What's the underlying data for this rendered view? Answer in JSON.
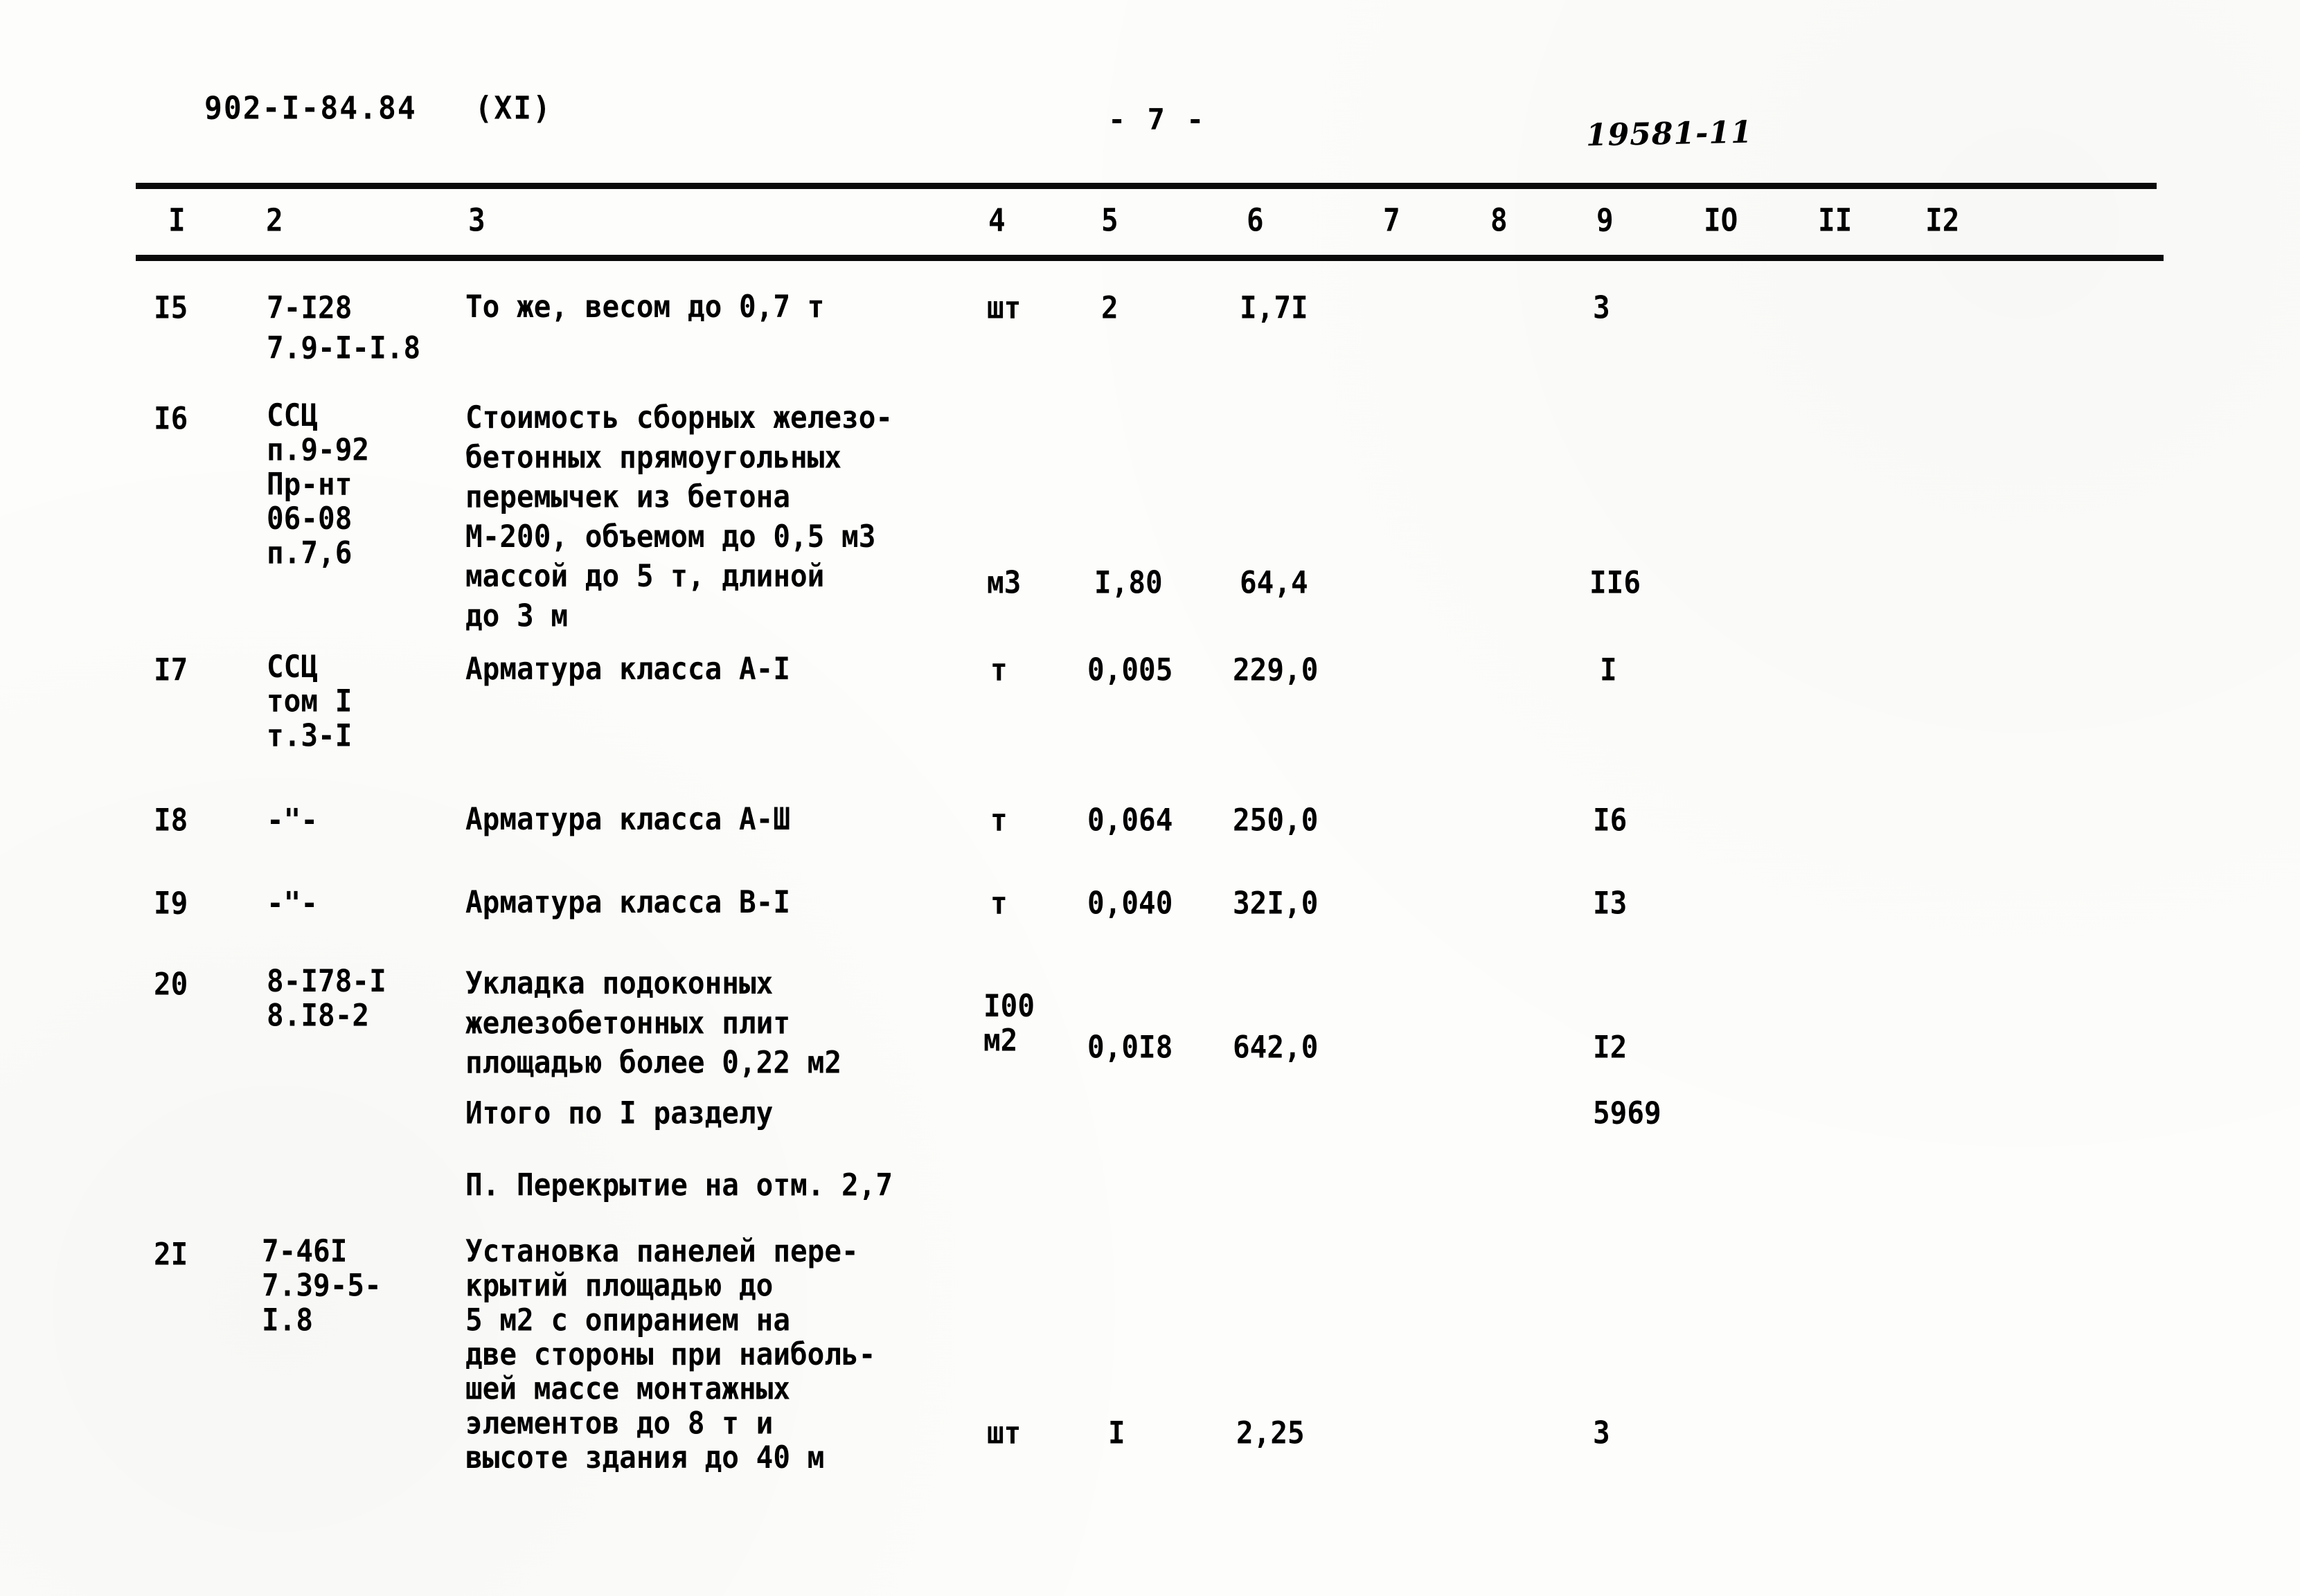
{
  "header": {
    "doc_code": "902-I-84.84   (XI)",
    "page_number": "- 7 -",
    "stamp_number": "19581-11"
  },
  "table": {
    "column_headers": [
      "I",
      "2",
      "3",
      "4",
      "5",
      "6",
      "7",
      "8",
      "9",
      "IO",
      "II",
      "I2"
    ],
    "rows": [
      {
        "num": "I5",
        "code": "7-I28\n7.9-I-I.8",
        "description": "То же, весом до 0,7 т",
        "unit": "шт",
        "qty": "2",
        "price": "I,7I",
        "col7": "",
        "col8": "",
        "total": "3"
      },
      {
        "num": "I6",
        "code": "ССЦ\nп.9-92\nПр-нт\n06-08\nп.7,6",
        "description": "Стоимость сборных железо-\nбетонных прямоугольных\nперемычек из бетона\nМ-200, объемом до 0,5 м3\nмассой до 5 т, длиной\nдо 3 м",
        "unit": "м3",
        "qty": "I,80",
        "price": "64,4",
        "col7": "",
        "col8": "",
        "total": "II6"
      },
      {
        "num": "I7",
        "code": "ССЦ\nтом I\nт.3-I",
        "description": "Арматура класса А-I",
        "unit": "т",
        "qty": "0,005",
        "price": "229,0",
        "col7": "",
        "col8": "",
        "total": "I"
      },
      {
        "num": "I8",
        "code": "-\"-",
        "description": "Арматура класса А-Ш",
        "unit": "т",
        "qty": "0,064",
        "price": "250,0",
        "col7": "",
        "col8": "",
        "total": "I6"
      },
      {
        "num": "I9",
        "code": "-\"-",
        "description": "Арматура класса В-I",
        "unit": "т",
        "qty": "0,040",
        "price": "32I,0",
        "col7": "",
        "col8": "",
        "total": "I3"
      },
      {
        "num": "20",
        "code": "8-I78-I\n8.I8-2",
        "description": "Укладка подоконных\nжелезобетонных плит\nплощадью более 0,22 м2",
        "unit": "I00\nм2",
        "qty": "0,0I8",
        "price": "642,0",
        "col7": "",
        "col8": "",
        "total": "I2"
      },
      {
        "num": "2I",
        "code": "7-46I\n7.39-5-\nI.8",
        "description": "Установка панелей пере-\nкрытий площадью до\n5 м2 с опиранием на\nдве стороны при наиболь-\nшей массе монтажных\nэлементов до 8 т и\nвысоте здания до 40 м",
        "unit": "шт",
        "qty": "I",
        "price": "2,25",
        "col7": "",
        "col8": "",
        "total": "3"
      }
    ],
    "subtotal": {
      "label": "Итого по I разделу",
      "value": "5969"
    },
    "section_heading": "П. Перекрытие на отм. 2,7"
  }
}
